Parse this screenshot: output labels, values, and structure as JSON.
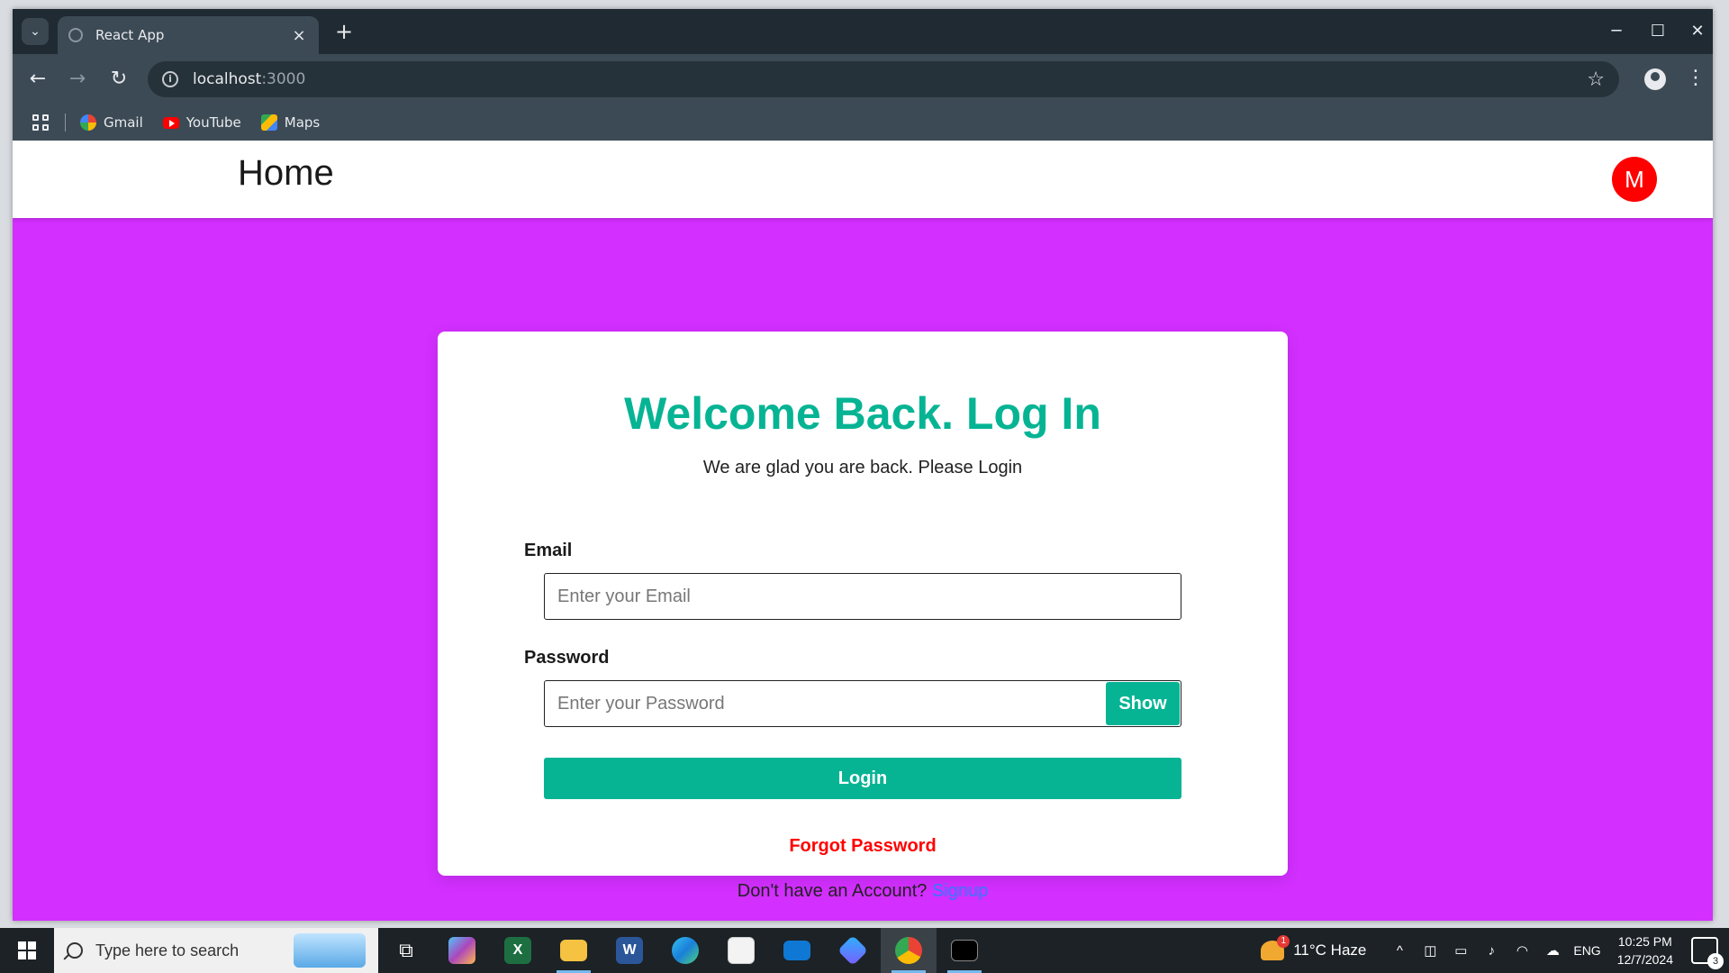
{
  "browser": {
    "tab_title": "React App",
    "url_host": "localhost",
    "url_port": ":3000",
    "bookmarks": [
      {
        "label": "Gmail",
        "icon": "gmail-icon"
      },
      {
        "label": "YouTube",
        "icon": "youtube-icon"
      },
      {
        "label": "Maps",
        "icon": "maps-icon"
      }
    ]
  },
  "app": {
    "header_title": "Home",
    "avatar_letter": "M",
    "background_color": "#d32fff",
    "accent_color": "#06b494"
  },
  "login": {
    "title": "Welcome Back. Log In",
    "subtitle": "We are glad you are back. Please Login",
    "email_label": "Email",
    "email_placeholder": "Enter your Email",
    "password_label": "Password",
    "password_placeholder": "Enter your Password",
    "show_label": "Show",
    "login_label": "Login",
    "forgot_label": "Forgot Password",
    "signup_prompt": "Don't have an Account?",
    "signup_label": "Signup"
  },
  "taskbar": {
    "search_placeholder": "Type here to search",
    "weather": "11°C  Haze",
    "weather_badge": "1",
    "language": "ENG",
    "time": "10:25 PM",
    "date": "12/7/2024",
    "notification_count": "3"
  }
}
